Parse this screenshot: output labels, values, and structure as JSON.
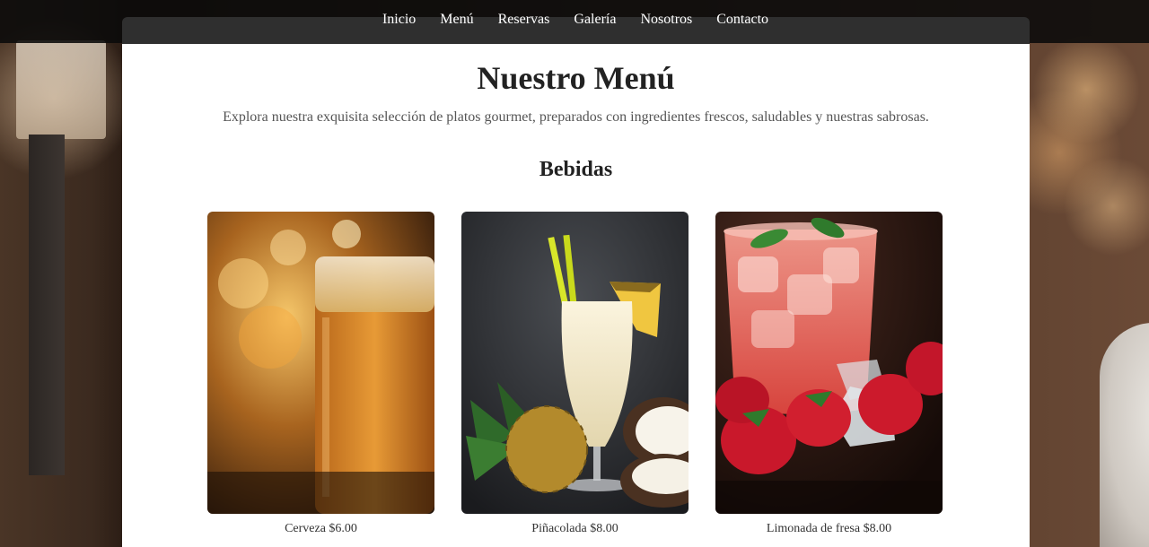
{
  "nav": {
    "links": [
      "Inicio",
      "Menú",
      "Reservas",
      "Galería",
      "Nosotros",
      "Contacto"
    ]
  },
  "main": {
    "title": "Nuestro Menú",
    "subtitle": "Explora nuestra exquisita selección de platos gourmet, preparados con ingredientes frescos, saludables y nuestras sabrosas.",
    "section_title": "Bebidas",
    "items": [
      {
        "label": "Cerveza $6.00",
        "image": "beer-glass-image"
      },
      {
        "label": "Piñacolada $8.00",
        "image": "pina-colada-image"
      },
      {
        "label": "Limonada de fresa $8.00",
        "image": "strawberry-lemonade-image"
      }
    ]
  },
  "colors": {
    "nav_bg": "#0a0a0a",
    "nav_tab": "#2f2f2f",
    "panel_bg": "#ffffff",
    "heading": "#222222"
  }
}
